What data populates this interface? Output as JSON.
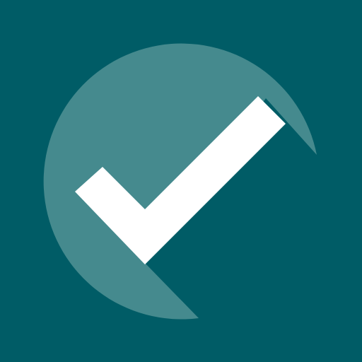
{
  "icon": {
    "name": "checkmark-icon",
    "colors": {
      "background": "#005c66",
      "circle": "#458a8e",
      "check": "#ffffff"
    }
  }
}
